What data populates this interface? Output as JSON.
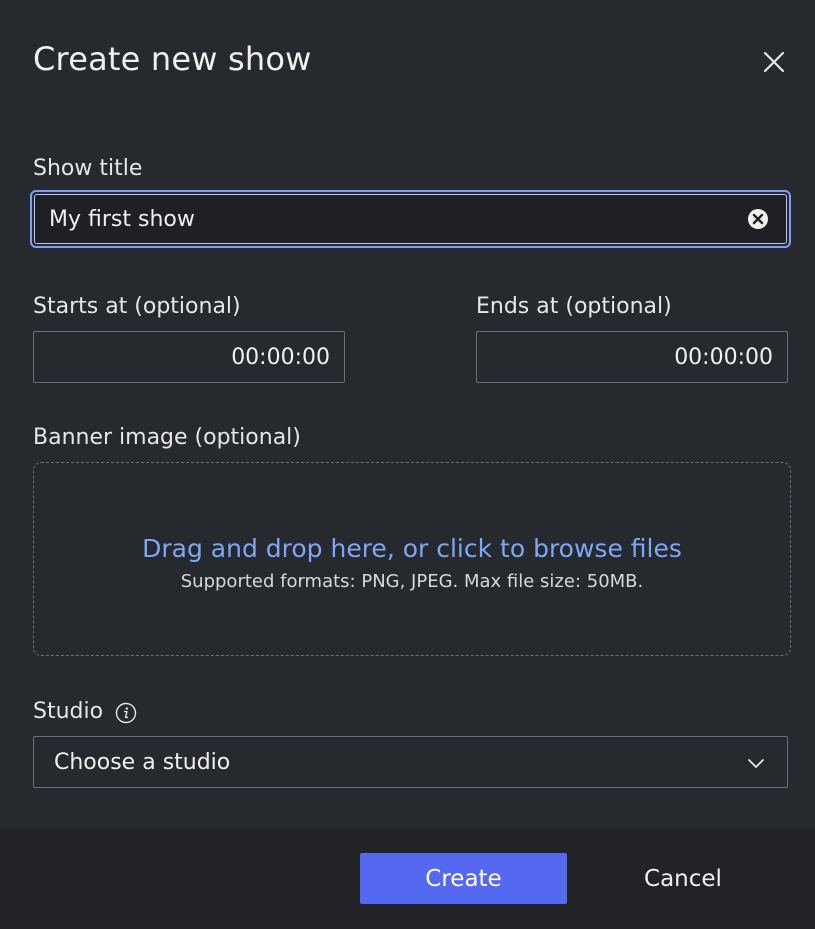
{
  "dialog": {
    "title": "Create new show",
    "close_icon": "close-icon"
  },
  "show_title": {
    "label": "Show title",
    "value": "My first show",
    "clear_icon": "clear-circle-x-icon"
  },
  "starts_at": {
    "label": "Starts at (optional)",
    "value": "00:00:00"
  },
  "ends_at": {
    "label": "Ends at (optional)",
    "value": "00:00:00"
  },
  "banner": {
    "label": "Banner image (optional)",
    "drop_text": "Drag and drop here, or click to browse files",
    "hint": "Supported formats: PNG, JPEG. Max file size: 50MB."
  },
  "studio": {
    "label": "Studio",
    "info_icon": "info-icon",
    "selected": "Choose a studio",
    "chevron_icon": "chevron-down-icon"
  },
  "footer": {
    "create_label": "Create",
    "cancel_label": "Cancel"
  },
  "colors": {
    "background": "#26292d",
    "footer": "#212327",
    "accent": "#5568f0",
    "focus_border": "#7f9ff7",
    "link": "#7fa7f5",
    "border": "#6b6f75"
  }
}
